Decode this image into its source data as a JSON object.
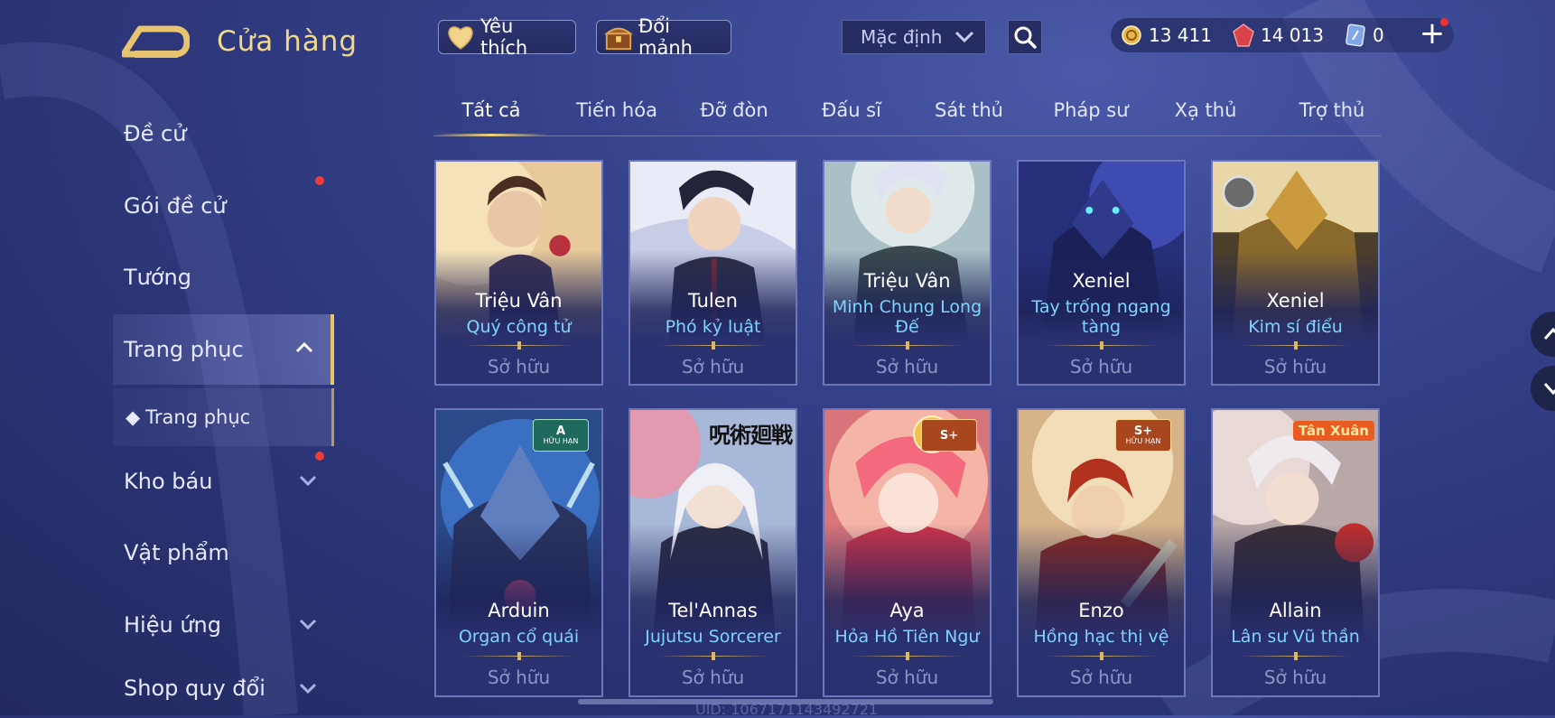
{
  "header": {
    "title": "Cửa hàng",
    "favorites_label": "Yêu thích",
    "exchange_label": "Đổi mảnh",
    "sort_value": "Mặc định"
  },
  "currency": {
    "gold": "13 411",
    "gems": "14 013",
    "vouchers": "0"
  },
  "sidebar": {
    "items": [
      {
        "label": "Đề cử"
      },
      {
        "label": "Gói đề cử"
      },
      {
        "label": "Tướng"
      },
      {
        "label": "Trang phục"
      },
      {
        "label": "Trang phục"
      },
      {
        "label": "Kho báu"
      },
      {
        "label": "Vật phẩm"
      },
      {
        "label": "Hiệu ứng"
      },
      {
        "label": "Shop quy đổi"
      }
    ]
  },
  "tabs": [
    "Tất cả",
    "Tiến hóa",
    "Đỡ đòn",
    "Đấu sĩ",
    "Sát thủ",
    "Pháp sư",
    "Xạ thủ",
    "Trợ thủ"
  ],
  "cards": [
    {
      "hero": "Triệu Vân",
      "skin": "Quý công tử",
      "status": "Sở hữu"
    },
    {
      "hero": "Tulen",
      "skin": "Phó kỷ luật",
      "status": "Sở hữu"
    },
    {
      "hero": "Triệu Vân",
      "skin": "Minh Chung Long Đế",
      "status": "Sở hữu"
    },
    {
      "hero": "Xeniel",
      "skin": "Tay trống ngang tàng",
      "status": "Sở hữu"
    },
    {
      "hero": "Xeniel",
      "skin": "Kim sí điểu",
      "status": "Sở hữu"
    },
    {
      "hero": "Arduin",
      "skin": "Organ cổ quái",
      "status": "Sở hữu",
      "badge": {
        "tier": "A",
        "sub": "HỮU HẠN"
      }
    },
    {
      "hero": "Tel'Annas",
      "skin": "Jujutsu Sorcerer",
      "status": "Sở hữu",
      "logo": "呪術廻戦"
    },
    {
      "hero": "Aya",
      "skin": "Hỏa Hồ Tiên Ngư",
      "status": "Sở hữu",
      "badge": {
        "tier": "S+",
        "sub": ""
      }
    },
    {
      "hero": "Enzo",
      "skin": "Hồng hạc thị vệ",
      "status": "Sở hữu",
      "badge": {
        "tier": "S+",
        "sub": "HỮU HẠN"
      }
    },
    {
      "hero": "Allain",
      "skin": "Lân sư Vũ thần",
      "status": "Sở hữu",
      "logo": "Tân Xuân"
    }
  ],
  "footer": {
    "uid": "UID: 1067171143492721"
  },
  "colors": {
    "accent_gold": "#e8c46a",
    "skin_name": "#7fd3ff",
    "badge_dot": "#f03030"
  },
  "icons": {
    "back": "back-arrow-icon",
    "favorites": "heart-icon",
    "exchange": "treasure-chest-icon",
    "search": "search-icon",
    "gold": "gold-coin-icon",
    "gems": "red-gem-icon",
    "vouchers": "voucher-card-icon",
    "add": "plus-icon"
  }
}
